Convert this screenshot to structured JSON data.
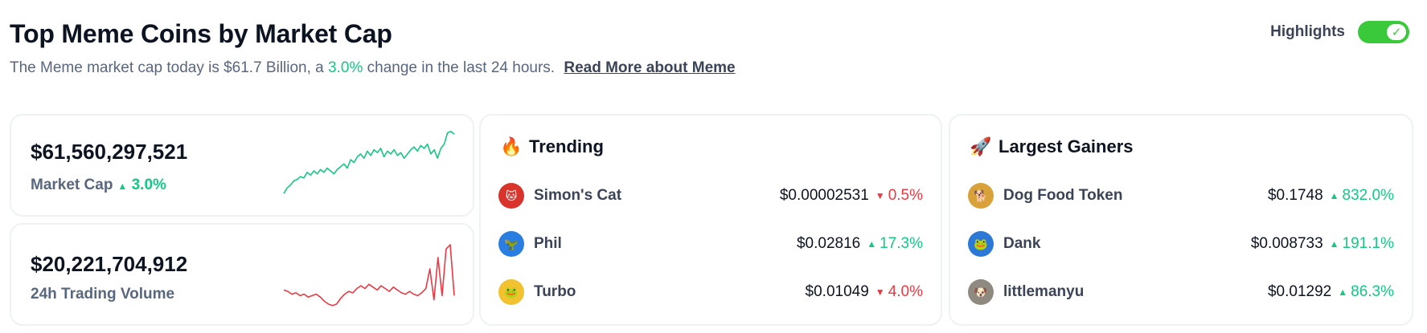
{
  "header": {
    "title": "Top Meme Coins by Market Cap",
    "subtitle_pre": "The Meme market cap today is $61.7 Billion, a ",
    "subtitle_change": "3.0%",
    "subtitle_post": " change in the last 24 hours.",
    "read_more": "Read More about Meme"
  },
  "highlights": {
    "label": "Highlights",
    "enabled": true,
    "check_glyph": "✓"
  },
  "market_cap": {
    "value": "$61,560,297,521",
    "label": "Market Cap",
    "change": "3.0%",
    "change_dir": "up",
    "spark_color": "#16c784",
    "spark": [
      0.1,
      0.18,
      0.22,
      0.28,
      0.3,
      0.34,
      0.32,
      0.4,
      0.36,
      0.42,
      0.38,
      0.44,
      0.4,
      0.46,
      0.42,
      0.38,
      0.44,
      0.48,
      0.52,
      0.46,
      0.58,
      0.54,
      0.62,
      0.66,
      0.6,
      0.7,
      0.64,
      0.72,
      0.68,
      0.74,
      0.62,
      0.7,
      0.66,
      0.72,
      0.64,
      0.68,
      0.6,
      0.66,
      0.72,
      0.76,
      0.7,
      0.78,
      0.74,
      0.8,
      0.66,
      0.72,
      0.6,
      0.74,
      0.8,
      0.96,
      0.98,
      0.94
    ]
  },
  "volume": {
    "value": "$20,221,704,912",
    "label": "24h Trading Volume",
    "spark_color": "#ea3943",
    "spark": [
      0.28,
      0.26,
      0.22,
      0.24,
      0.2,
      0.22,
      0.18,
      0.2,
      0.22,
      0.18,
      0.12,
      0.08,
      0.06,
      0.08,
      0.16,
      0.22,
      0.26,
      0.24,
      0.3,
      0.34,
      0.3,
      0.36,
      0.32,
      0.28,
      0.34,
      0.3,
      0.26,
      0.32,
      0.28,
      0.24,
      0.22,
      0.26,
      0.22,
      0.2,
      0.24,
      0.3,
      0.58,
      0.14,
      0.74,
      0.2,
      0.86,
      0.92,
      0.2
    ]
  },
  "trending": {
    "title": "Trending",
    "icon": "fire-icon",
    "glyph": "🔥",
    "items": [
      {
        "name": "Simon's Cat",
        "price": "$0.00002531",
        "change": "0.5%",
        "dir": "down",
        "avatar_color": "#d9342b",
        "avatar_glyph": "🐱"
      },
      {
        "name": "Phil",
        "price": "$0.02816",
        "change": "17.3%",
        "dir": "up",
        "avatar_color": "#2a7de1",
        "avatar_glyph": "🦖"
      },
      {
        "name": "Turbo",
        "price": "$0.01049",
        "change": "4.0%",
        "dir": "down",
        "avatar_color": "#f2c230",
        "avatar_glyph": "🐸"
      }
    ]
  },
  "gainers": {
    "title": "Largest Gainers",
    "icon": "rocket-icon",
    "glyph": "🚀",
    "items": [
      {
        "name": "Dog Food Token",
        "price": "$0.1748",
        "change": "832.0%",
        "dir": "up",
        "avatar_color": "#d8a13a",
        "avatar_glyph": "🐕"
      },
      {
        "name": "Dank",
        "price": "$0.008733",
        "change": "191.1%",
        "dir": "up",
        "avatar_color": "#2b78d6",
        "avatar_glyph": "🐸"
      },
      {
        "name": "littlemanyu",
        "price": "$0.01292",
        "change": "86.3%",
        "dir": "up",
        "avatar_color": "#8f8a80",
        "avatar_glyph": "🐶"
      }
    ]
  }
}
